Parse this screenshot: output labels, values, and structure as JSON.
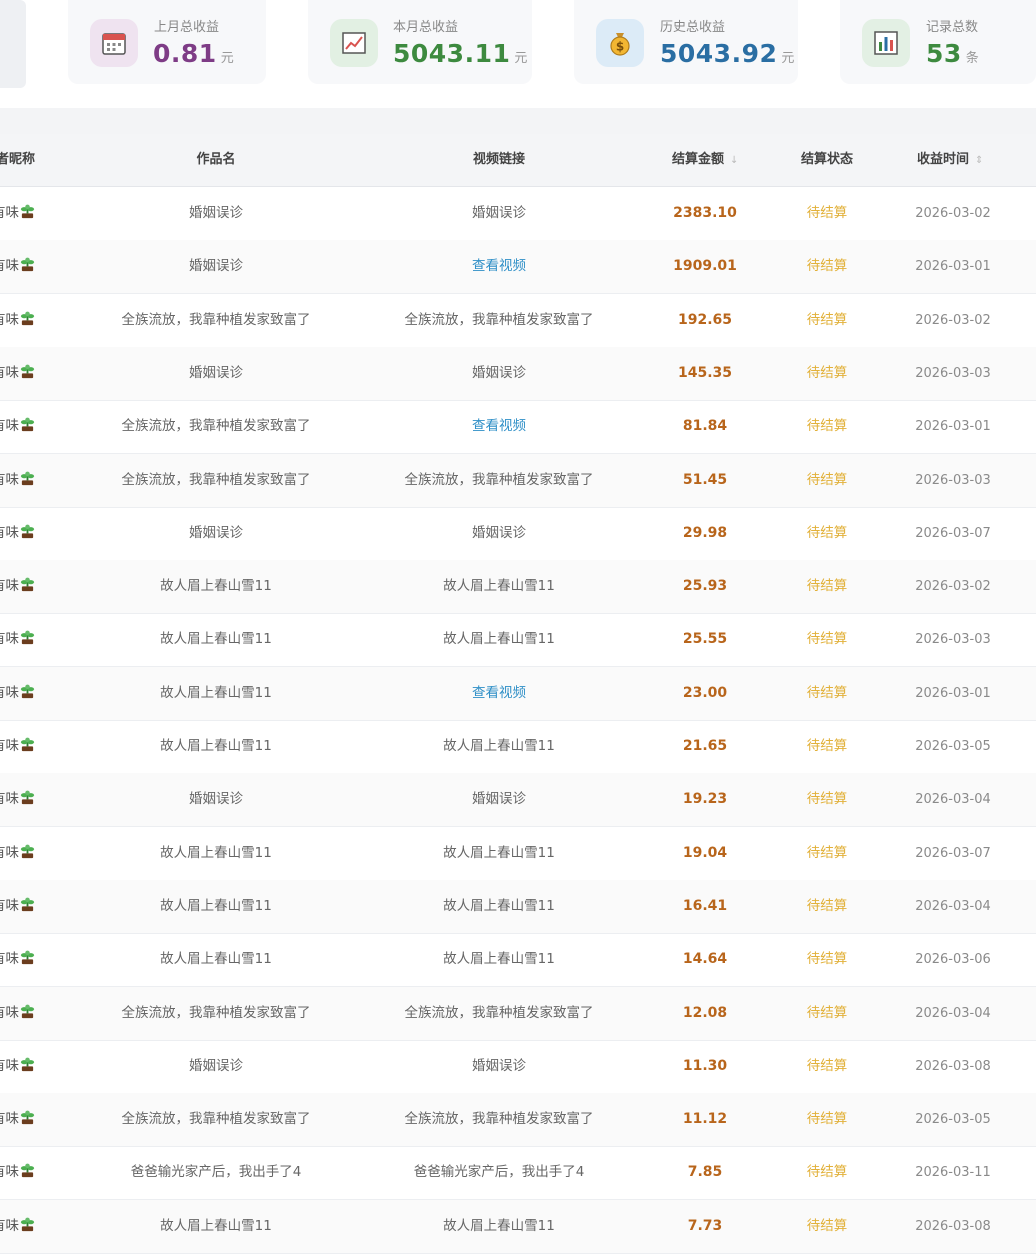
{
  "colors": {
    "purple": "#7e3c86",
    "green": "#3d8a3f",
    "blue": "#2a6ea3",
    "amount": "#b8651b",
    "status": "#e2b13a",
    "link": "#2f8fc7"
  },
  "stats": [
    {
      "label": "上月总收益",
      "value": "0.81",
      "unit": "元",
      "icon": "calendar-icon"
    },
    {
      "label": "本月总收益",
      "value": "5043.11",
      "unit": "元",
      "icon": "trend-chart-icon"
    },
    {
      "label": "历史总收益",
      "value": "5043.92",
      "unit": "元",
      "icon": "money-bag-icon"
    },
    {
      "label": "记录总数",
      "value": "53",
      "unit": "条",
      "icon": "bar-chart-icon"
    }
  ],
  "table": {
    "headers": {
      "nickname": "者昵称",
      "work": "作品名",
      "video": "视频链接",
      "amount": "结算金额",
      "status": "结算状态",
      "time": "收益时间"
    },
    "rows": [
      {
        "nickname": "有味",
        "work": "婚姻误诊",
        "video": "婚姻误诊",
        "amount": "2383.10",
        "status": "待结算",
        "date": "2026-03-02"
      },
      {
        "nickname": "有味",
        "work": "婚姻误诊",
        "video": "查看视频",
        "amount": "1909.01",
        "status": "待结算",
        "date": "2026-03-01"
      },
      {
        "nickname": "有味",
        "work": "全族流放，我靠种植发家致富了",
        "video": "全族流放，我靠种植发家致富了",
        "amount": "192.65",
        "status": "待结算",
        "date": "2026-03-02"
      },
      {
        "nickname": "有味",
        "work": "婚姻误诊",
        "video": "婚姻误诊",
        "amount": "145.35",
        "status": "待结算",
        "date": "2026-03-03"
      },
      {
        "nickname": "有味",
        "work": "全族流放，我靠种植发家致富了",
        "video": "查看视频",
        "amount": "81.84",
        "status": "待结算",
        "date": "2026-03-01"
      },
      {
        "nickname": "有味",
        "work": "全族流放，我靠种植发家致富了",
        "video": "全族流放，我靠种植发家致富了",
        "amount": "51.45",
        "status": "待结算",
        "date": "2026-03-03"
      },
      {
        "nickname": "有味",
        "work": "婚姻误诊",
        "video": "婚姻误诊",
        "amount": "29.98",
        "status": "待结算",
        "date": "2026-03-07"
      },
      {
        "nickname": "有味",
        "work": "故人眉上春山雪11",
        "video": "故人眉上春山雪11",
        "amount": "25.93",
        "status": "待结算",
        "date": "2026-03-02"
      },
      {
        "nickname": "有味",
        "work": "故人眉上春山雪11",
        "video": "故人眉上春山雪11",
        "amount": "25.55",
        "status": "待结算",
        "date": "2026-03-03"
      },
      {
        "nickname": "有味",
        "work": "故人眉上春山雪11",
        "video": "查看视频",
        "amount": "23.00",
        "status": "待结算",
        "date": "2026-03-01"
      },
      {
        "nickname": "有味",
        "work": "故人眉上春山雪11",
        "video": "故人眉上春山雪11",
        "amount": "21.65",
        "status": "待结算",
        "date": "2026-03-05"
      },
      {
        "nickname": "有味",
        "work": "婚姻误诊",
        "video": "婚姻误诊",
        "amount": "19.23",
        "status": "待结算",
        "date": "2026-03-04"
      },
      {
        "nickname": "有味",
        "work": "故人眉上春山雪11",
        "video": "故人眉上春山雪11",
        "amount": "19.04",
        "status": "待结算",
        "date": "2026-03-07"
      },
      {
        "nickname": "有味",
        "work": "故人眉上春山雪11",
        "video": "故人眉上春山雪11",
        "amount": "16.41",
        "status": "待结算",
        "date": "2026-03-04"
      },
      {
        "nickname": "有味",
        "work": "故人眉上春山雪11",
        "video": "故人眉上春山雪11",
        "amount": "14.64",
        "status": "待结算",
        "date": "2026-03-06"
      },
      {
        "nickname": "有味",
        "work": "全族流放，我靠种植发家致富了",
        "video": "全族流放，我靠种植发家致富了",
        "amount": "12.08",
        "status": "待结算",
        "date": "2026-03-04"
      },
      {
        "nickname": "有味",
        "work": "婚姻误诊",
        "video": "婚姻误诊",
        "amount": "11.30",
        "status": "待结算",
        "date": "2026-03-08"
      },
      {
        "nickname": "有味",
        "work": "全族流放，我靠种植发家致富了",
        "video": "全族流放，我靠种植发家致富了",
        "amount": "11.12",
        "status": "待结算",
        "date": "2026-03-05"
      },
      {
        "nickname": "有味",
        "work": "爸爸输光家产后，我出手了4",
        "video": "爸爸输光家产后，我出手了4",
        "amount": "7.85",
        "status": "待结算",
        "date": "2026-03-11"
      },
      {
        "nickname": "有味",
        "work": "故人眉上春山雪11",
        "video": "故人眉上春山雪11",
        "amount": "7.73",
        "status": "待结算",
        "date": "2026-03-08"
      }
    ]
  }
}
